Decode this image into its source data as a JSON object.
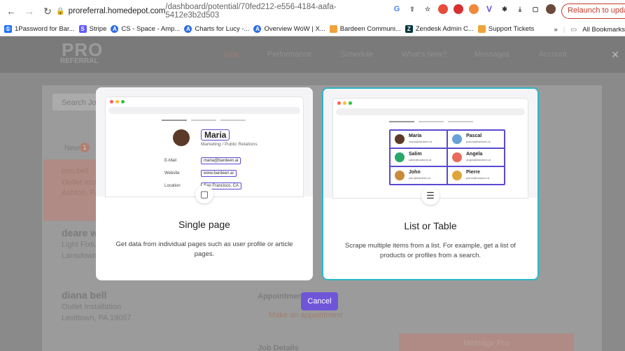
{
  "browser": {
    "url_host": "proreferral.homedepot.com",
    "url_path": "/dashboard/potential/70fed212-e556-4184-aafa-5412e3b2d503",
    "relaunch_label": "Relaunch to update"
  },
  "bookmarks": {
    "items": [
      {
        "label": "1Password for Bar...",
        "color": "#1a6ff4"
      },
      {
        "label": "Stripe",
        "color": "#635bff"
      },
      {
        "label": "CS - Space - Amp...",
        "color": "#2f6de1"
      },
      {
        "label": "Charts for Lucy -...",
        "color": "#2f6de1"
      },
      {
        "label": "Overview WoW | X...",
        "color": "#2f6de1"
      },
      {
        "label": "Bardeen Communi...",
        "color": "#f0a33a"
      },
      {
        "label": "Zendesk Admin C...",
        "color": "#03363d"
      },
      {
        "label": "Support Tickets",
        "color": "#f0a33a"
      }
    ],
    "more": "»",
    "all_bookmarks": "All Bookmarks"
  },
  "site": {
    "logo_pro": "PRO",
    "logo_referral": "REFERRAL",
    "nav": [
      "Jobs",
      "Performance",
      "Schedule",
      "What's New?",
      "Messages",
      "Account"
    ]
  },
  "background": {
    "search_placeholder": "Search Jo",
    "new_label": "New",
    "new_count": "1",
    "job1_name": "tom bell",
    "job1_line1": "Outlet Install",
    "job1_line2": "Ashton, PA",
    "job2_name": "deare wo",
    "job2_line1": "Light Fixtu",
    "job2_line2": "Lansdowne",
    "job3_name": "diana bell",
    "job3_line1": "Outlet Installation",
    "job3_line2": "Levittown, PA 19057",
    "appointment": "Appointmen",
    "make_appointment": "Make an appointment",
    "job_details": "Job Details",
    "message_pro": "Message Pro"
  },
  "modal": {
    "single": {
      "title": "Single page",
      "description": "Get data from individual pages such as user profile or article pages.",
      "mock_name": "Maria",
      "mock_role": "Marketing / Public Relations",
      "mock_rows": [
        {
          "label": "E-Mail",
          "value": "maria@bardeen.ai"
        },
        {
          "label": "Website",
          "value": "www.bardeen.ai"
        },
        {
          "label": "Location",
          "value": "San Francisco, CA"
        }
      ]
    },
    "list": {
      "title": "List or Table",
      "description": "Scrape multiple items from a list. For example, get a list of products or profiles from a search.",
      "people": [
        {
          "name": "Maria",
          "email": "maria@bardeen.ai",
          "color": "#5b3a29"
        },
        {
          "name": "Pascal",
          "email": "pascal@bardeen.ai",
          "color": "#6aa1d8"
        },
        {
          "name": "Salim",
          "email": "salim@bardeen.ai",
          "color": "#2aa86a"
        },
        {
          "name": "Angela",
          "email": "angela@bardeen.ai",
          "color": "#e86a5a"
        },
        {
          "name": "John",
          "email": "john@bardeen.ai",
          "color": "#c98a3a"
        },
        {
          "name": "Pierre",
          "email": "pierre@bardeen.ai",
          "color": "#e0a53a"
        }
      ]
    },
    "cancel_label": "Cancel"
  }
}
